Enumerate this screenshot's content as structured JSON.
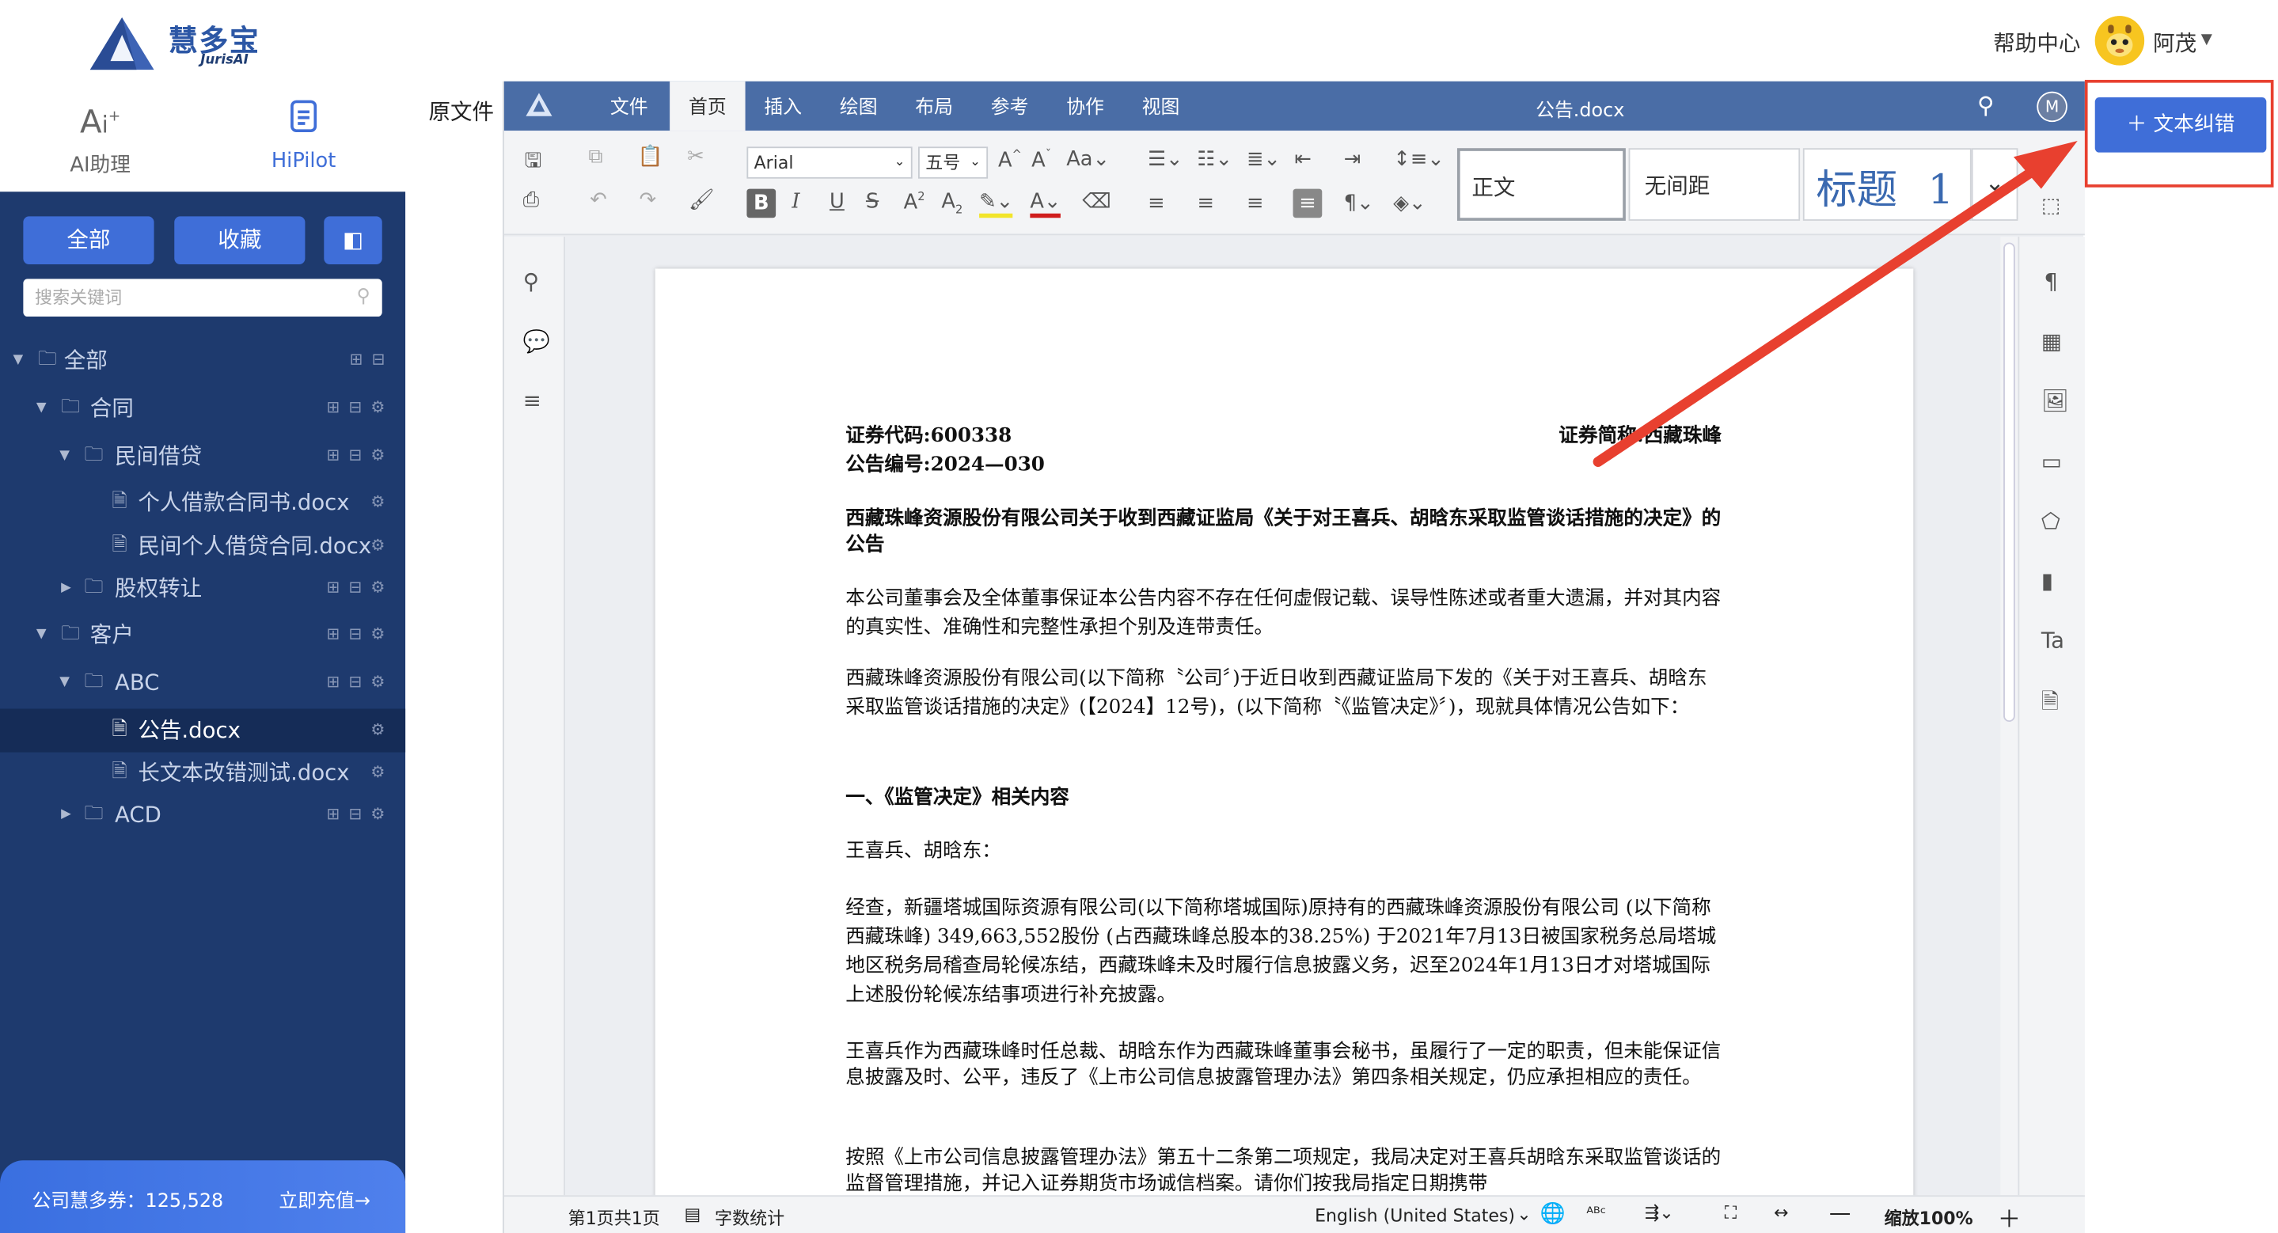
{
  "header": {
    "brand_name": "慧多宝",
    "brand_sub": "JurisAI",
    "help_label": "帮助中心",
    "username": "阿茂"
  },
  "sidebar": {
    "tabs": [
      {
        "label": "AI助理",
        "icon": "ai-icon"
      },
      {
        "label": "HiPilot",
        "icon": "document-icon"
      }
    ],
    "buttons": {
      "all": "全部",
      "favorites": "收藏"
    },
    "search_placeholder": "搜索关键词",
    "tree": [
      {
        "label": "全部"
      },
      {
        "label": "合同"
      },
      {
        "label": "民间借贷"
      },
      {
        "label": "个人借款合同书.docx"
      },
      {
        "label": "民间个人借贷合同.docx"
      },
      {
        "label": "股权转让"
      },
      {
        "label": "客户"
      },
      {
        "label": "ABC"
      },
      {
        "label": "公告.docx",
        "selected": true
      },
      {
        "label": "长文本改错测试.docx"
      },
      {
        "label": "ACD"
      }
    ],
    "credits_label": "公司慧多券：125,528",
    "recharge_label": "立即充值→"
  },
  "origin_label": "原文件",
  "editor": {
    "menu_tabs": [
      "文件",
      "首页",
      "插入",
      "绘图",
      "布局",
      "参考",
      "协作",
      "视图"
    ],
    "active_tab": "首页",
    "doc_title": "公告.docx",
    "user_initial": "M",
    "font_name": "Arial",
    "font_size": "五号",
    "styles": [
      "正文",
      "无间距",
      "标题 1"
    ],
    "status": {
      "page_info": "第1页共1页",
      "word_count": "字数统计",
      "language": "English (United States)",
      "zoom": "缩放100%"
    }
  },
  "document": {
    "code_line": "证券代码:600338",
    "abbr_line": "证券简称:西藏珠峰",
    "number_line": "公告编号:2024—030",
    "title": "西藏珠峰资源股份有限公司关于收到西藏证监局《关于对王喜兵、胡晗东采取监管谈话措施的决定》的公告",
    "para1": "本公司董事会及全体董事保证本公告内容不存在任何虚假记载、误导性陈述或者重大遗漏，并对其内容的真实性、准确性和完整性承担个别及连带责任。",
    "para2": "西藏珠峰资源股份有限公司(以下简称〝公司〞)于近日收到西藏证监局下发的《关于对王喜兵、胡晗东采取监管谈话措施的决定》(【2024】12号)，(以下简称〝《监管决定》〞)，现就具体情况公告如下：",
    "section1": "一、《监管决定》相关内容",
    "salutation": "王喜兵、胡晗东：",
    "para3": "经查，新疆塔城国际资源有限公司(以下简称塔城国际)原持有的西藏珠峰资源股份有限公司 (以下简称西藏珠峰) 349,663,552股份 (占西藏珠峰总股本的38.25%) 于2021年7月13日被国家税务总局塔城地区税务局稽查局轮候冻结，西藏珠峰未及时履行信息披露义务，迟至2024年1月13日才对塔城国际上述股份轮候冻结事项进行补充披露。",
    "para4": "王喜兵作为西藏珠峰时任总裁、胡晗东作为西藏珠峰董事会秘书，虽履行了一定的职责，但未能保证信息披露及时、公平，违反了《上市公司信息披露管理办法》第四条相关规定，仍应承担相应的责任。",
    "para5": "按照《上市公司信息披露管理办法》第五十二条第二项规定，我局决定对王喜兵胡晗东采取监管谈话的监督管理措施，并记入证券期货市场诚信档案。请你们按我局指定日期携带"
  },
  "correction_button": "＋ 文本纠错"
}
